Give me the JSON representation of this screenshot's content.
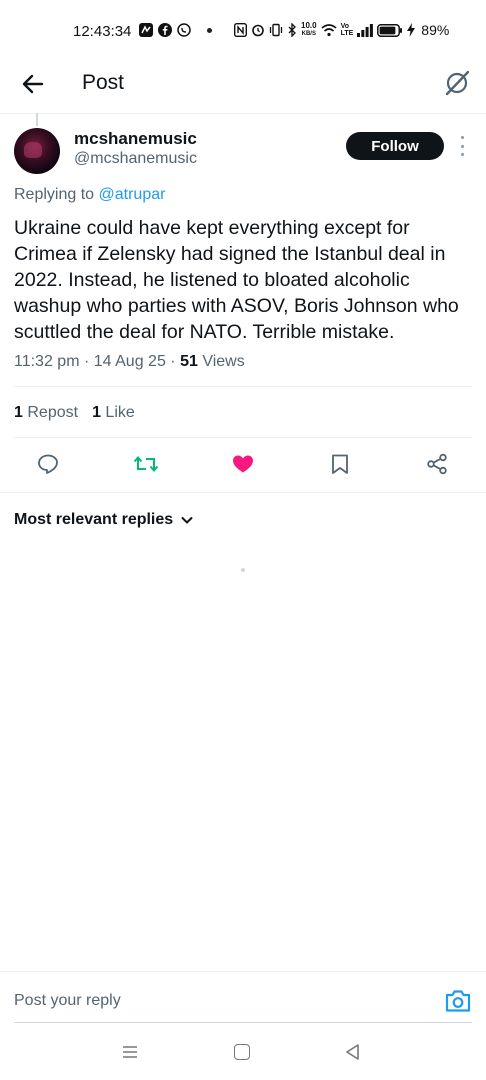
{
  "status_bar": {
    "time": "12:43:34",
    "net_speed_value": "10.0",
    "net_speed_unit": "KB/S",
    "volte_top": "Vo",
    "volte_bottom": "LTE",
    "battery_percent": "89%",
    "battery_level": 0.89,
    "icons": [
      "nfc-icon",
      "alarm-icon",
      "vibrate-icon",
      "bluetooth-icon",
      "wifi-icon",
      "signal-icon",
      "battery-icon",
      "charging-icon"
    ]
  },
  "header": {
    "title": "Post",
    "back_icon": "arrow-left-icon",
    "right_icon": "grok-icon"
  },
  "post": {
    "display_name": "mcshanemusic",
    "handle": "@mcshanemusic",
    "follow_label": "Follow",
    "replying_prefix": "Replying to",
    "replying_to": "@atrupar",
    "text": "Ukraine could have kept everything except for Crimea if Zelensky had signed the Istanbul deal in 2022. Instead, he listened to bloated alcoholic washup who parties with ASOV, Boris Johnson who scuttled the deal for NATO. Terrible mistake.",
    "time": "11:32 pm",
    "date": "14 Aug 25",
    "views_count": "51",
    "views_label": "Views",
    "reposts_count": "1",
    "reposts_label": "Repost",
    "likes_count": "1",
    "likes_label": "Like"
  },
  "actions": {
    "reply_icon": "reply-icon",
    "repost_icon": "repost-icon",
    "like_icon": "heart-icon",
    "bookmark_icon": "bookmark-icon",
    "share_icon": "share-icon",
    "repost_color": "#00ba7c",
    "like_color": "#f91880"
  },
  "replies": {
    "sort_label": "Most relevant replies"
  },
  "reply_bar": {
    "placeholder": "Post your reply",
    "camera_icon": "camera-icon",
    "accent": "#1d9bf0"
  },
  "nav_bar": {
    "icons": [
      "menu-icon",
      "home-icon",
      "back-triangle-icon"
    ]
  }
}
